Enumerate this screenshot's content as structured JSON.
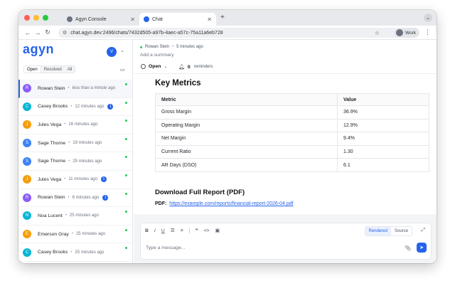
{
  "browser": {
    "tabs": [
      {
        "label": "Agyn Console",
        "icon_color": "#6b7280"
      },
      {
        "label": "Chat",
        "icon_color": "#2563eb"
      }
    ],
    "url": "chat.agyn.dev:2496/chats/7432d505-a97b-4aec-a57c-75a11a6eb728",
    "profile_label": "Work"
  },
  "sidebar": {
    "logo": "agyn",
    "user_initial": "V",
    "filters": [
      "Open",
      "Resolved",
      "All"
    ],
    "items": [
      {
        "name": "Rowan Stein",
        "time": "less than a minute ago",
        "initial": "R",
        "color": "#8b5cf6",
        "badge": ""
      },
      {
        "name": "Casey Brooks",
        "time": "12 minutes ago",
        "initial": "C",
        "color": "#06b6d4",
        "badge": "1"
      },
      {
        "name": "Jules Vega",
        "time": "16 minutes ago",
        "initial": "J",
        "color": "#f59e0b",
        "badge": ""
      },
      {
        "name": "Sage Thorne",
        "time": "19 minutes ago",
        "initial": "S",
        "color": "#3b82f6",
        "badge": ""
      },
      {
        "name": "Sage Thorne",
        "time": "25 minutes ago",
        "initial": "S",
        "color": "#3b82f6",
        "badge": ""
      },
      {
        "name": "Jules Vega",
        "time": "11 minutes ago",
        "initial": "J",
        "color": "#f59e0b",
        "badge": "1"
      },
      {
        "name": "Rowan Stein",
        "time": "6 minutes ago",
        "initial": "R",
        "color": "#8b5cf6",
        "badge": "1"
      },
      {
        "name": "Noa Lucent",
        "time": "25 minutes ago",
        "initial": "N",
        "color": "#06b6d4",
        "badge": ""
      },
      {
        "name": "Emerson Gray",
        "time": "25 minutes ago",
        "initial": "E",
        "color": "#f59e0b",
        "badge": ""
      },
      {
        "name": "Casey Brooks",
        "time": "25 minutes ago",
        "initial": "C",
        "color": "#06b6d4",
        "badge": ""
      }
    ]
  },
  "chat": {
    "participant": "Rowan Stein",
    "time": "5 minutes ago",
    "summary_placeholder": "Add a summary",
    "status": "Open",
    "reminders_count": "0",
    "reminders_label": "reminders"
  },
  "message": {
    "heading": "Key Metrics",
    "table": {
      "headers": [
        "Metric",
        "Value"
      ],
      "rows": [
        [
          "Gross Margin",
          "36.9%"
        ],
        [
          "Operating Margin",
          "12.9%"
        ],
        [
          "Net Margin",
          "9.4%"
        ],
        [
          "Current Ratio",
          "1.30"
        ],
        [
          "AR Days (DSO)",
          "6.1"
        ]
      ]
    },
    "download_heading": "Download Full Report (PDF)",
    "pdf_label": "PDF:",
    "pdf_link": "https://example.com/reports/financial-report-2026-04.pdf"
  },
  "composer": {
    "modes": [
      "Rendered",
      "Source"
    ],
    "placeholder": "Type a message..."
  }
}
